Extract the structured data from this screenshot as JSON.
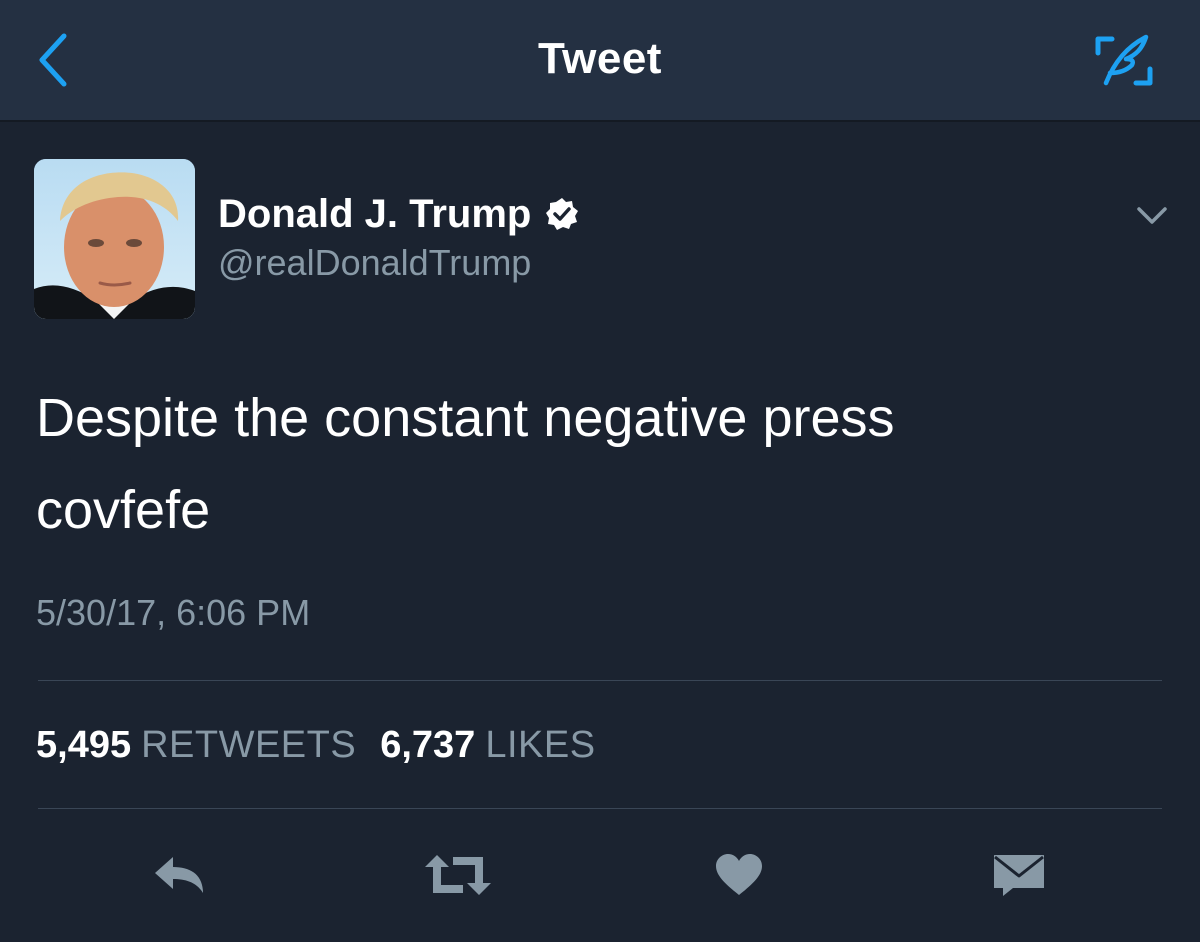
{
  "navbar": {
    "title": "Tweet",
    "back_icon": "chevron-left-icon",
    "compose_icon": "compose-tweet-icon",
    "accent_color": "#1da1f2"
  },
  "tweet": {
    "author": {
      "name": "Donald J. Trump",
      "handle": "@realDonaldTrump",
      "verified": true
    },
    "text_lines": [
      "Despite the constant negative press",
      "covfefe"
    ],
    "timestamp": "5/30/17, 6:06 PM",
    "stats": {
      "retweets_count": "5,495",
      "retweets_label": "RETWEETS",
      "likes_count": "6,737",
      "likes_label": "LIKES"
    },
    "actions": [
      "reply-icon",
      "retweet-icon",
      "like-icon",
      "direct-message-icon"
    ]
  },
  "colors": {
    "background": "#1b2330",
    "navbar": "#243042",
    "text_primary": "#ffffff",
    "text_secondary": "#8899a6",
    "icon": "#8899a6"
  }
}
